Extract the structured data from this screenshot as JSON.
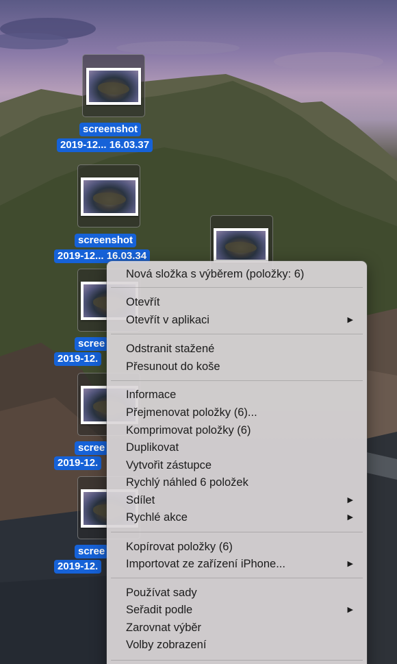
{
  "desktop_icons": [
    {
      "name": "screenshot",
      "date": "2019-12... 16.03.37",
      "show_name": true
    },
    {
      "name": "screenshot",
      "date": "2019-12... 16.03.34",
      "show_name": true
    },
    {
      "name": "scree",
      "date": "2019-12.",
      "show_name": true
    },
    {
      "name": "scree",
      "date": "2019-12.",
      "show_name": true
    },
    {
      "name": "scree",
      "date": "2019-12.",
      "show_name": true
    },
    {
      "name": "",
      "date": "",
      "show_name": false
    }
  ],
  "context_menu": {
    "items": [
      {
        "label": "Nová složka s výběrem (položky: 6)",
        "submenu": false
      },
      {
        "label": "Otevřít",
        "submenu": false
      },
      {
        "label": "Otevřít v aplikaci",
        "submenu": true
      },
      {
        "label": "Odstranit stažené",
        "submenu": false
      },
      {
        "label": "Přesunout do koše",
        "submenu": false
      },
      {
        "label": "Informace",
        "submenu": false
      },
      {
        "label": "Přejmenovat položky (6)...",
        "submenu": false
      },
      {
        "label": "Komprimovat položky (6)",
        "submenu": false
      },
      {
        "label": "Duplikovat",
        "submenu": false
      },
      {
        "label": "Vytvořit zástupce",
        "submenu": false
      },
      {
        "label": "Rychlý náhled 6 položek",
        "submenu": false
      },
      {
        "label": "Sdílet",
        "submenu": true
      },
      {
        "label": "Rychlé akce",
        "submenu": true
      },
      {
        "label": "Kopírovat položky (6)",
        "submenu": false
      },
      {
        "label": "Importovat ze zařízení iPhone...",
        "submenu": true
      },
      {
        "label": "Používat sady",
        "submenu": false
      },
      {
        "label": "Seřadit podle",
        "submenu": true
      },
      {
        "label": "Zarovnat výběr",
        "submenu": false
      },
      {
        "label": "Volby zobrazení",
        "submenu": false
      }
    ],
    "submenu_arrow": "▶"
  },
  "colors": {
    "selection_blue": "#1662d8",
    "menu_background": "#dad6d8"
  }
}
